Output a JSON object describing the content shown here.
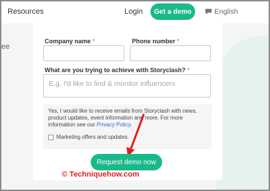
{
  "nav": {
    "resources": "Resources",
    "login": "Login",
    "cta": "Get a demo",
    "language": "English"
  },
  "left_fragment": "ee",
  "form": {
    "company_label": "Company name",
    "phone_label": "Phone number",
    "required_mark": "*",
    "goal_label": "What are you trying to achieve with Storyclash?",
    "goal_placeholder": "E.g. I'd like to find & monitor influencers",
    "consent_text": "Yes, I would like to receive emails from Storyclash with news, product updates, event information and more. For more information see our",
    "privacy_link": "Privacy Policy",
    "consent_end": ".",
    "marketing_label": "Marketing offers and updates.",
    "marketing_checked": false,
    "submit": "Request demo now"
  },
  "watermark": "© Techniquehow.com",
  "colors": {
    "accent": "#1ab98a",
    "annotation": "#e0201e",
    "link": "#2a6fd6"
  }
}
